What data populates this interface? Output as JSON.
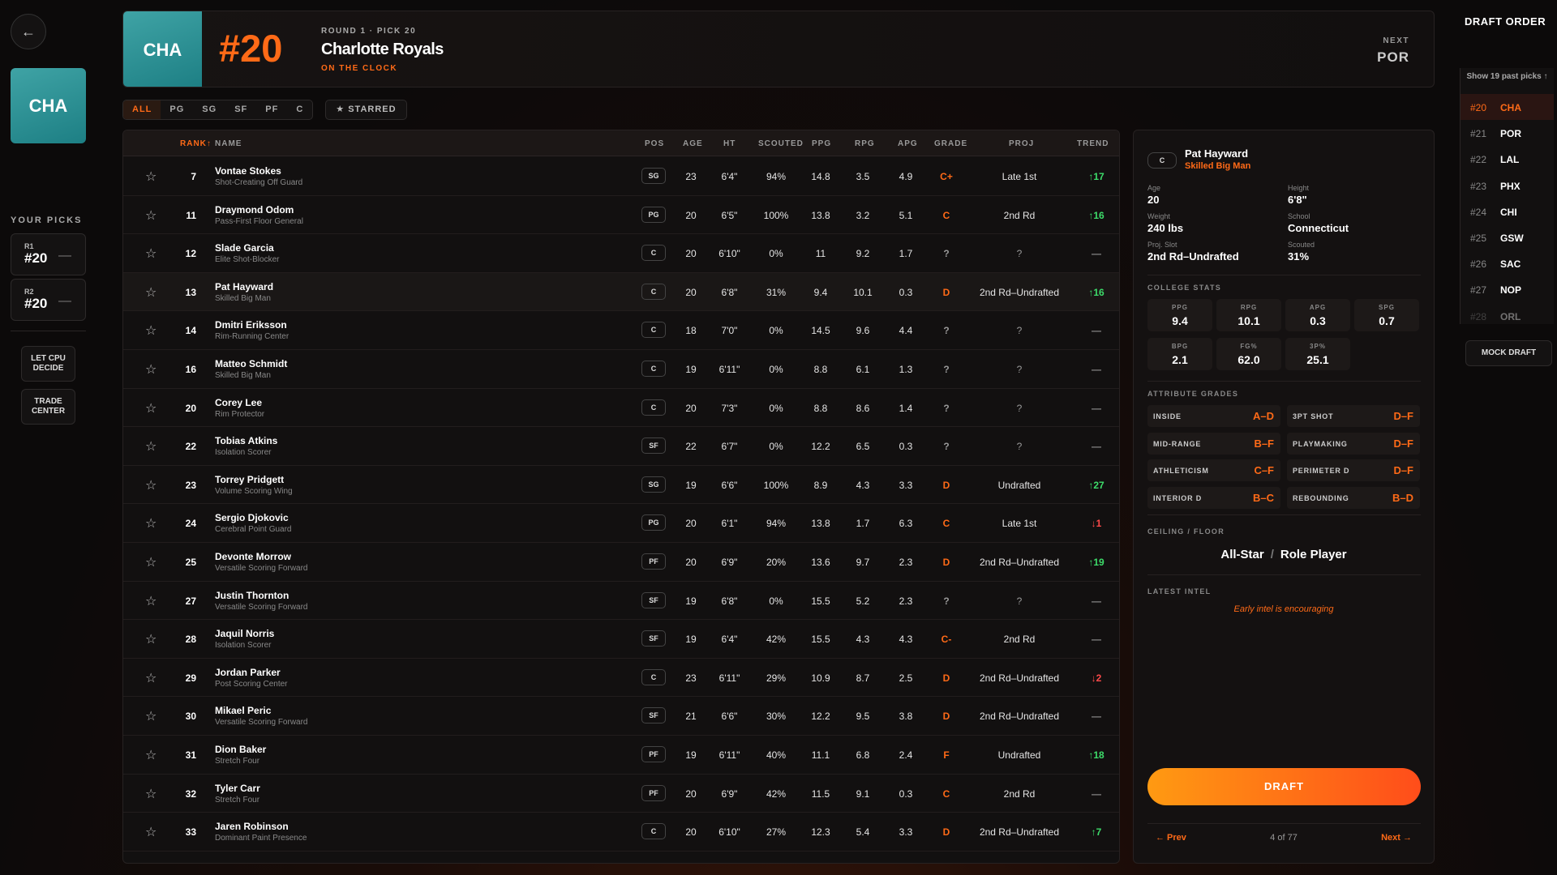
{
  "team": {
    "abbr": "CHA",
    "name": "Charlotte Royals",
    "pick_label": "#20",
    "round_info": "ROUND 1 · PICK 20",
    "status": "ON THE CLOCK",
    "next_label": "NEXT",
    "next_team": "POR"
  },
  "sidebar": {
    "your_picks_label": "YOUR PICKS",
    "picks": [
      {
        "round": "R1",
        "num": "#20"
      },
      {
        "round": "R2",
        "num": "#20"
      }
    ],
    "cpu_label": "LET CPU DECIDE",
    "trade_label": "TRADE CENTER"
  },
  "filters": {
    "tabs": [
      "ALL",
      "PG",
      "SG",
      "SF",
      "PF",
      "C"
    ],
    "starred_label": "★ STARRED"
  },
  "table": {
    "headers": {
      "rank": "RANK↑",
      "name": "NAME",
      "pos": "POS",
      "age": "AGE",
      "ht": "HT",
      "scouted": "SCOUTED",
      "ppg": "PPG",
      "rpg": "RPG",
      "apg": "APG",
      "grade": "GRADE",
      "proj": "PROJ",
      "trend": "TREND"
    },
    "rows": [
      {
        "rank": "7",
        "name": "Vontae Stokes",
        "arch": "Shot-Creating Off Guard",
        "pos": "SG",
        "age": "23",
        "ht": "6'4\"",
        "scouted": "94%",
        "ppg": "14.8",
        "rpg": "3.5",
        "apg": "4.9",
        "grade": "C+",
        "proj": "Late 1st",
        "trend": "↑17"
      },
      {
        "rank": "11",
        "name": "Draymond Odom",
        "arch": "Pass-First Floor General",
        "pos": "PG",
        "age": "20",
        "ht": "6'5\"",
        "scouted": "100%",
        "ppg": "13.8",
        "rpg": "3.2",
        "apg": "5.1",
        "grade": "C",
        "proj": "2nd Rd",
        "trend": "↑16"
      },
      {
        "rank": "12",
        "name": "Slade Garcia",
        "arch": "Elite Shot-Blocker",
        "pos": "C",
        "age": "20",
        "ht": "6'10\"",
        "scouted": "0%",
        "ppg": "11",
        "rpg": "9.2",
        "apg": "1.7",
        "grade": "?",
        "proj": "?",
        "trend": "—"
      },
      {
        "rank": "13",
        "name": "Pat Hayward",
        "arch": "Skilled Big Man",
        "pos": "C",
        "age": "20",
        "ht": "6'8\"",
        "scouted": "31%",
        "ppg": "9.4",
        "rpg": "10.1",
        "apg": "0.3",
        "grade": "D",
        "proj": "2nd Rd–Undrafted",
        "trend": "↑16"
      },
      {
        "rank": "14",
        "name": "Dmitri Eriksson",
        "arch": "Rim-Running Center",
        "pos": "C",
        "age": "18",
        "ht": "7'0\"",
        "scouted": "0%",
        "ppg": "14.5",
        "rpg": "9.6",
        "apg": "4.4",
        "grade": "?",
        "proj": "?",
        "trend": "—"
      },
      {
        "rank": "16",
        "name": "Matteo Schmidt",
        "arch": "Skilled Big Man",
        "pos": "C",
        "age": "19",
        "ht": "6'11\"",
        "scouted": "0%",
        "ppg": "8.8",
        "rpg": "6.1",
        "apg": "1.3",
        "grade": "?",
        "proj": "?",
        "trend": "—"
      },
      {
        "rank": "20",
        "name": "Corey Lee",
        "arch": "Rim Protector",
        "pos": "C",
        "age": "20",
        "ht": "7'3\"",
        "scouted": "0%",
        "ppg": "8.8",
        "rpg": "8.6",
        "apg": "1.4",
        "grade": "?",
        "proj": "?",
        "trend": "—"
      },
      {
        "rank": "22",
        "name": "Tobias Atkins",
        "arch": "Isolation Scorer",
        "pos": "SF",
        "age": "22",
        "ht": "6'7\"",
        "scouted": "0%",
        "ppg": "12.2",
        "rpg": "6.5",
        "apg": "0.3",
        "grade": "?",
        "proj": "?",
        "trend": "—"
      },
      {
        "rank": "23",
        "name": "Torrey Pridgett",
        "arch": "Volume Scoring Wing",
        "pos": "SG",
        "age": "19",
        "ht": "6'6\"",
        "scouted": "100%",
        "ppg": "8.9",
        "rpg": "4.3",
        "apg": "3.3",
        "grade": "D",
        "proj": "Undrafted",
        "trend": "↑27"
      },
      {
        "rank": "24",
        "name": "Sergio Djokovic",
        "arch": "Cerebral Point Guard",
        "pos": "PG",
        "age": "20",
        "ht": "6'1\"",
        "scouted": "94%",
        "ppg": "13.8",
        "rpg": "1.7",
        "apg": "6.3",
        "grade": "C",
        "proj": "Late 1st",
        "trend": "↓1"
      },
      {
        "rank": "25",
        "name": "Devonte Morrow",
        "arch": "Versatile Scoring Forward",
        "pos": "PF",
        "age": "20",
        "ht": "6'9\"",
        "scouted": "20%",
        "ppg": "13.6",
        "rpg": "9.7",
        "apg": "2.3",
        "grade": "D",
        "proj": "2nd Rd–Undrafted",
        "trend": "↑19"
      },
      {
        "rank": "27",
        "name": "Justin Thornton",
        "arch": "Versatile Scoring Forward",
        "pos": "SF",
        "age": "19",
        "ht": "6'8\"",
        "scouted": "0%",
        "ppg": "15.5",
        "rpg": "5.2",
        "apg": "2.3",
        "grade": "?",
        "proj": "?",
        "trend": "—"
      },
      {
        "rank": "28",
        "name": "Jaquil Norris",
        "arch": "Isolation Scorer",
        "pos": "SF",
        "age": "19",
        "ht": "6'4\"",
        "scouted": "42%",
        "ppg": "15.5",
        "rpg": "4.3",
        "apg": "4.3",
        "grade": "C-",
        "proj": "2nd Rd",
        "trend": "—"
      },
      {
        "rank": "29",
        "name": "Jordan Parker",
        "arch": "Post Scoring Center",
        "pos": "C",
        "age": "23",
        "ht": "6'11\"",
        "scouted": "29%",
        "ppg": "10.9",
        "rpg": "8.7",
        "apg": "2.5",
        "grade": "D",
        "proj": "2nd Rd–Undrafted",
        "trend": "↓2"
      },
      {
        "rank": "30",
        "name": "Mikael Peric",
        "arch": "Versatile Scoring Forward",
        "pos": "SF",
        "age": "21",
        "ht": "6'6\"",
        "scouted": "30%",
        "ppg": "12.2",
        "rpg": "9.5",
        "apg": "3.8",
        "grade": "D",
        "proj": "2nd Rd–Undrafted",
        "trend": "—"
      },
      {
        "rank": "31",
        "name": "Dion Baker",
        "arch": "Stretch Four",
        "pos": "PF",
        "age": "19",
        "ht": "6'11\"",
        "scouted": "40%",
        "ppg": "11.1",
        "rpg": "6.8",
        "apg": "2.4",
        "grade": "F",
        "proj": "Undrafted",
        "trend": "↑18"
      },
      {
        "rank": "32",
        "name": "Tyler Carr",
        "arch": "Stretch Four",
        "pos": "PF",
        "age": "20",
        "ht": "6'9\"",
        "scouted": "42%",
        "ppg": "11.5",
        "rpg": "9.1",
        "apg": "0.3",
        "grade": "C",
        "proj": "2nd Rd",
        "trend": "—"
      },
      {
        "rank": "33",
        "name": "Jaren Robinson",
        "arch": "Dominant Paint Presence",
        "pos": "C",
        "age": "20",
        "ht": "6'10\"",
        "scouted": "27%",
        "ppg": "12.3",
        "rpg": "5.4",
        "apg": "3.3",
        "grade": "D",
        "proj": "2nd Rd–Undrafted",
        "trend": "↑7"
      }
    ]
  },
  "detail": {
    "pos": "C",
    "name": "Pat Hayward",
    "arch": "Skilled Big Man",
    "info": [
      {
        "label": "Age",
        "value": "20"
      },
      {
        "label": "Height",
        "value": "6'8\""
      },
      {
        "label": "Weight",
        "value": "240 lbs"
      },
      {
        "label": "School",
        "value": "Connecticut"
      },
      {
        "label": "Proj. Slot",
        "value": "2nd Rd–Undrafted"
      },
      {
        "label": "Scouted",
        "value": "31%"
      }
    ],
    "college_label": "COLLEGE STATS",
    "stats": [
      {
        "label": "PPG",
        "value": "9.4"
      },
      {
        "label": "RPG",
        "value": "10.1"
      },
      {
        "label": "APG",
        "value": "0.3"
      },
      {
        "label": "SPG",
        "value": "0.7"
      },
      {
        "label": "BPG",
        "value": "2.1"
      },
      {
        "label": "FG%",
        "value": "62.0"
      },
      {
        "label": "3P%",
        "value": "25.1"
      }
    ],
    "attr_label": "ATTRIBUTE GRADES",
    "attrs": [
      {
        "label": "INSIDE",
        "value": "A–D"
      },
      {
        "label": "3PT SHOT",
        "value": "D–F"
      },
      {
        "label": "MID-RANGE",
        "value": "B–F"
      },
      {
        "label": "PLAYMAKING",
        "value": "D–F"
      },
      {
        "label": "ATHLETICISM",
        "value": "C–F"
      },
      {
        "label": "PERIMETER D",
        "value": "D–F"
      },
      {
        "label": "INTERIOR D",
        "value": "B–C"
      },
      {
        "label": "REBOUNDING",
        "value": "B–D"
      }
    ],
    "ceiling_label": "CEILING / FLOOR",
    "ceiling": "All-Star",
    "floor": "Role Player",
    "intel_label": "LATEST INTEL",
    "intel": "Early intel is encouraging",
    "draft_label": "DRAFT",
    "prev_label": "← Prev",
    "count": "4 of 77",
    "next_label": "Next →"
  },
  "draft_order": {
    "title": "DRAFT ORDER",
    "show_label": "Show 19 past picks ↑",
    "items": [
      {
        "pick": "#20",
        "team": "CHA"
      },
      {
        "pick": "#21",
        "team": "POR"
      },
      {
        "pick": "#22",
        "team": "LAL"
      },
      {
        "pick": "#23",
        "team": "PHX"
      },
      {
        "pick": "#24",
        "team": "CHI"
      },
      {
        "pick": "#25",
        "team": "GSW"
      },
      {
        "pick": "#26",
        "team": "SAC"
      },
      {
        "pick": "#27",
        "team": "NOP"
      },
      {
        "pick": "#28",
        "team": "ORL"
      }
    ],
    "mock_label": "MOCK DRAFT"
  },
  "colors": {
    "accent": "#ff6a17",
    "up": "#3ddc6a",
    "down": "#ff4a4a",
    "team": "#2a9296"
  }
}
